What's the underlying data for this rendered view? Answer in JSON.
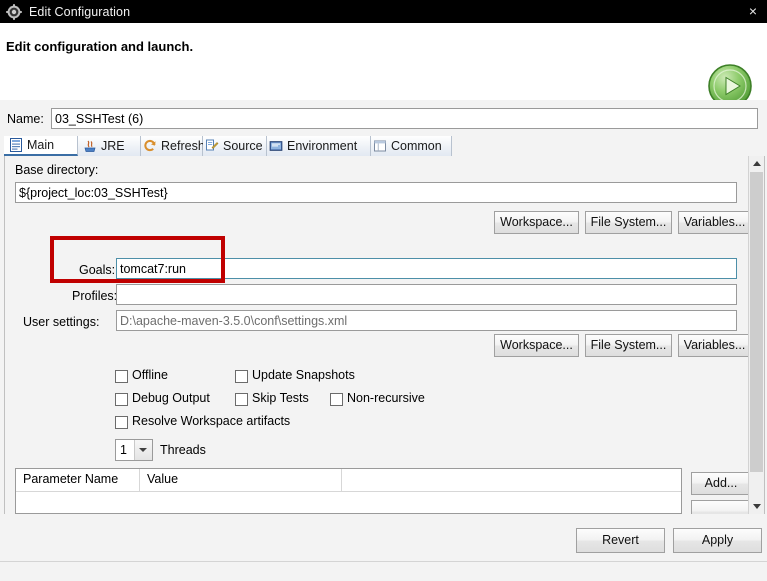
{
  "window": {
    "title": "Edit Configuration",
    "icon": "gear-icon",
    "close_label": "×"
  },
  "header": {
    "heading": "Edit configuration and launch.",
    "run_icon": "run-play-icon"
  },
  "name_row": {
    "label": "Name:",
    "value": "03_SSHTest (6)"
  },
  "tabs": [
    {
      "label": "Main",
      "icon": "main-document-icon",
      "active": true
    },
    {
      "label": "JRE",
      "icon": "jre-icon",
      "active": false
    },
    {
      "label": "Refresh",
      "icon": "refresh-icon",
      "active": false
    },
    {
      "label": "Source",
      "icon": "source-icon",
      "active": false
    },
    {
      "label": "Environment",
      "icon": "environment-icon",
      "active": false
    },
    {
      "label": "Common",
      "icon": "common-icon",
      "active": false
    }
  ],
  "main_tab": {
    "base_directory": {
      "label": "Base directory:",
      "value": "${project_loc:03_SSHTest}"
    },
    "dir_buttons": [
      {
        "label": "Workspace..."
      },
      {
        "label": "File System..."
      },
      {
        "label": "Variables..."
      }
    ],
    "goals": {
      "label": "Goals:",
      "value": "tomcat7:run"
    },
    "profiles": {
      "label": "Profiles:",
      "value": ""
    },
    "user_settings": {
      "label": "User settings:",
      "value": "D:\\apache-maven-3.5.0\\conf\\settings.xml"
    },
    "settings_buttons": [
      {
        "label": "Workspace..."
      },
      {
        "label": "File System..."
      },
      {
        "label": "Variables..."
      }
    ],
    "checkboxes": [
      {
        "label": "Offline",
        "checked": false
      },
      {
        "label": "Update Snapshots",
        "checked": false
      },
      {
        "label": "Debug Output",
        "checked": false
      },
      {
        "label": "Skip Tests",
        "checked": false
      },
      {
        "label": "Non-recursive",
        "checked": false
      },
      {
        "label": "Resolve Workspace artifacts",
        "checked": false
      }
    ],
    "threads": {
      "value": "1",
      "label": "Threads"
    },
    "parameter_table": {
      "columns": [
        "Parameter Name",
        "Value"
      ],
      "rows": []
    },
    "table_buttons": [
      {
        "label": "Add..."
      }
    ]
  },
  "footer": {
    "revert_label": "Revert",
    "apply_label": "Apply"
  },
  "colors": {
    "titlebar_bg": "#000000",
    "annotation": "#c00000",
    "accent_tab": "#3a6ea5",
    "run_green": "#5fb545",
    "body_bg": "#f3f3f3"
  }
}
